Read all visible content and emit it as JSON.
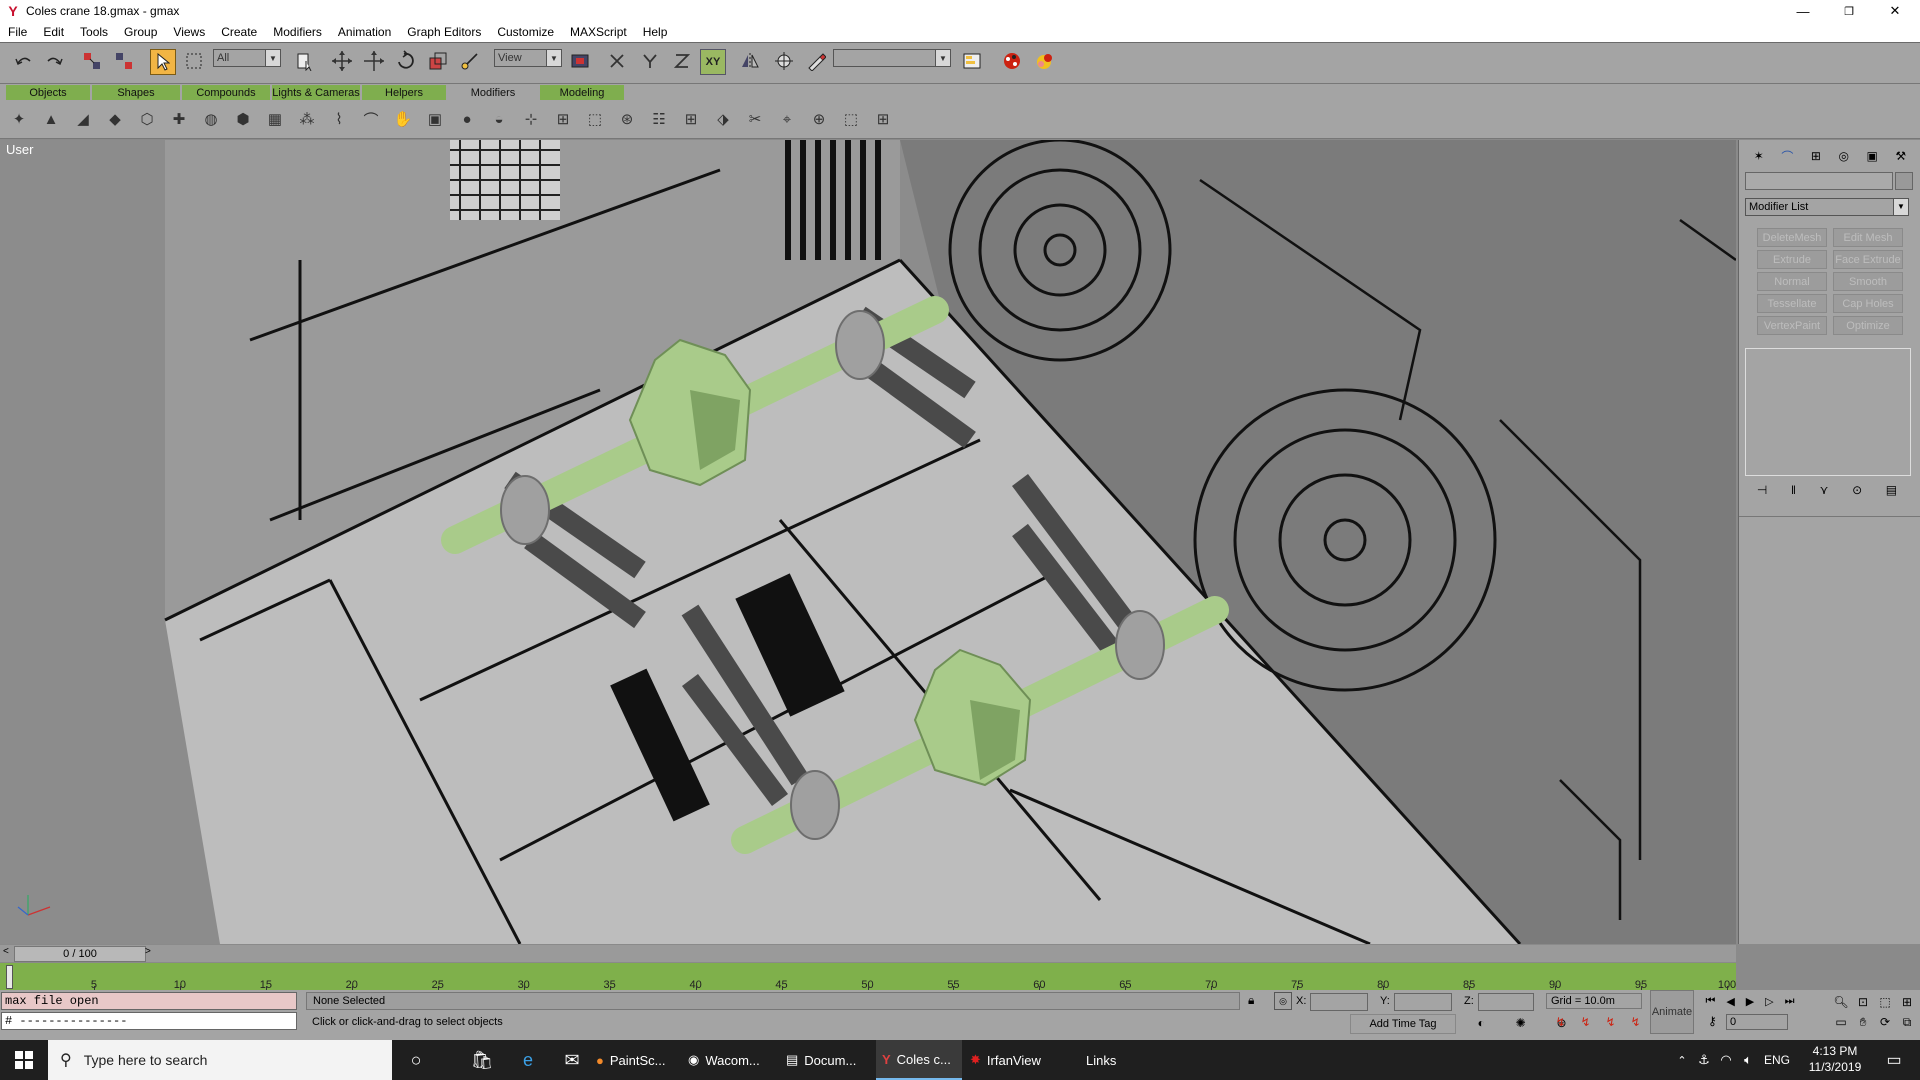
{
  "window": {
    "title": "Coles crane 18.gmax - gmax",
    "minimize_glyph": "—",
    "restore_glyph": "❐",
    "close_glyph": "✕"
  },
  "menu": [
    "File",
    "Edit",
    "Tools",
    "Group",
    "Views",
    "Create",
    "Modifiers",
    "Animation",
    "Graph Editors",
    "Customize",
    "MAXScript",
    "Help"
  ],
  "toolbar": {
    "selection_filter": "All",
    "reference_coord": "View",
    "named_selection": ""
  },
  "tabs": [
    {
      "label": "Objects",
      "active": false
    },
    {
      "label": "Shapes",
      "active": false
    },
    {
      "label": "Compounds",
      "active": false
    },
    {
      "label": "Lights & Cameras",
      "active": false
    },
    {
      "label": "Helpers",
      "active": false
    },
    {
      "label": "Modifiers",
      "active": true
    },
    {
      "label": "Modeling",
      "active": false
    }
  ],
  "viewport": {
    "label": "User"
  },
  "command_panel": {
    "modifier_list": "Modifier List",
    "buttons": [
      "DeleteMesh",
      "Edit Mesh",
      "Extrude",
      "Face Extrude",
      "Normal",
      "Smooth",
      "Tessellate",
      "Cap Holes",
      "VertexPaint",
      "Optimize"
    ]
  },
  "timeline": {
    "frame_display": "0 / 100",
    "ticks": [
      "5",
      "10",
      "15",
      "20",
      "25",
      "30",
      "35",
      "40",
      "45",
      "50",
      "55",
      "60",
      "65",
      "70",
      "75",
      "80",
      "85",
      "90",
      "95",
      "100"
    ]
  },
  "status": {
    "maxscript_line1": "max file open",
    "maxscript_line2": "# ---------------",
    "selection": "None Selected",
    "prompt": "Click or click-and-drag to select objects",
    "x_label": "X:",
    "y_label": "Y:",
    "z_label": "Z:",
    "grid": "Grid = 10.0m",
    "add_time_tag": "Add Time Tag",
    "animate": "Animate",
    "current_frame": "0"
  },
  "taskbar": {
    "search_placeholder": "Type here to search",
    "items": [
      {
        "label": "PaintSc...",
        "icon": "paint-icon"
      },
      {
        "label": "Wacom...",
        "icon": "wacom-icon"
      },
      {
        "label": "Docum...",
        "icon": "document-icon"
      },
      {
        "label": "Coles c...",
        "icon": "gmax-icon"
      },
      {
        "label": "IrfanView",
        "icon": "irfanview-icon"
      }
    ],
    "links": "Links",
    "language": "ENG",
    "time": "4:13 PM",
    "date": "11/3/2019"
  },
  "colors": {
    "accent_green": "#7fae4e",
    "panel_gray": "#a4a4a4",
    "selected_tool": "#f2b544",
    "model_green": "#a9cb8a"
  }
}
